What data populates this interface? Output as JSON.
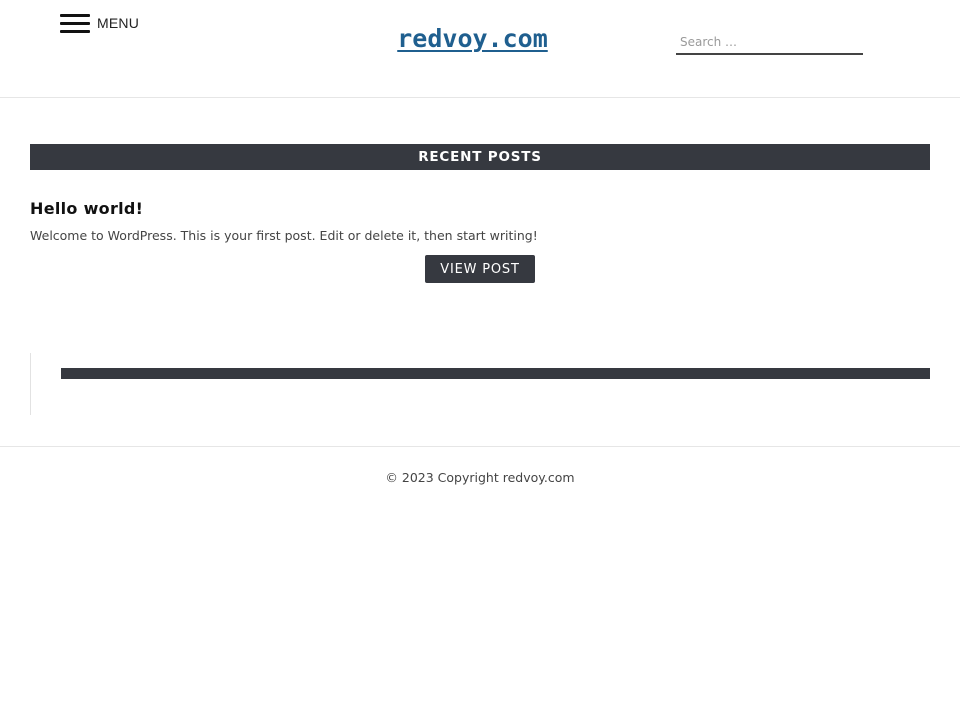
{
  "header": {
    "menu_label": "MENU",
    "site_title": "redvoy.com",
    "search_placeholder": "Search …"
  },
  "recent_posts": {
    "heading": "RECENT POSTS",
    "posts": [
      {
        "title": "Hello world!",
        "excerpt": "Welcome to WordPress. This is your first post. Edit or delete it, then start writing!",
        "button_label": "VIEW POST"
      }
    ]
  },
  "footer": {
    "copyright": "© 2023 Copyright redvoy.com"
  },
  "colors": {
    "accent_dark": "#363940",
    "title_blue": "#1f5f8f"
  },
  "icons": {
    "menu": "hamburger-icon"
  }
}
